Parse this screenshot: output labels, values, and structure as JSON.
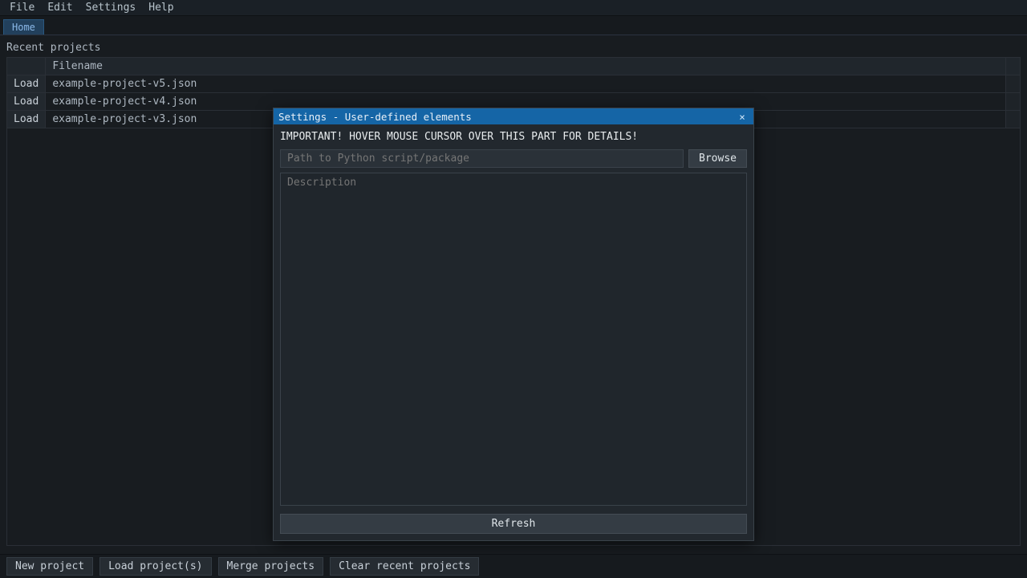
{
  "menubar": {
    "file": "File",
    "edit": "Edit",
    "settings": "Settings",
    "help": "Help"
  },
  "tabs": {
    "home": "Home"
  },
  "recent": {
    "heading": "Recent projects",
    "columns": {
      "filename": "Filename"
    },
    "load_label": "Load",
    "items": [
      {
        "filename": "example-project-v5.json"
      },
      {
        "filename": "example-project-v4.json"
      },
      {
        "filename": "example-project-v3.json"
      }
    ]
  },
  "bottom": {
    "new_project": "New project",
    "load_projects": "Load project(s)",
    "merge_projects": "Merge projects",
    "clear_recent": "Clear recent projects"
  },
  "dialog": {
    "title": "Settings - User-defined elements",
    "close_glyph": "×",
    "important": "IMPORTANT! HOVER MOUSE CURSOR OVER THIS PART FOR DETAILS!",
    "path_placeholder": "Path to Python script/package",
    "path_value": "",
    "browse": "Browse",
    "description_placeholder": "Description",
    "description_value": "",
    "refresh": "Refresh"
  }
}
